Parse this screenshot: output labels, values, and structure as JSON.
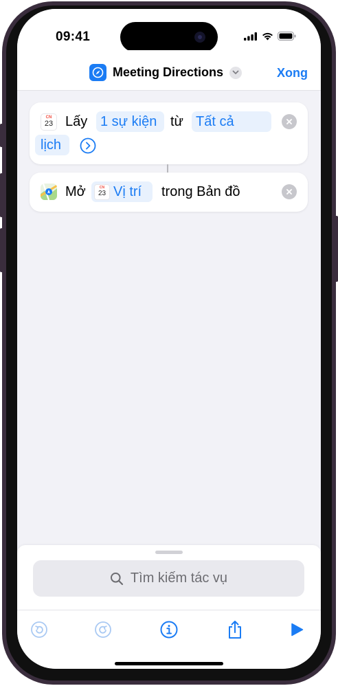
{
  "status_bar": {
    "time": "09:41"
  },
  "nav": {
    "title": "Meeting Directions",
    "done_label": "Xong"
  },
  "actions": [
    {
      "verb": "Lấy",
      "param_events": "1 sự kiện",
      "connector_word": "từ",
      "param_calendar_line1": "Tất cả",
      "param_calendar_line2": "lịch",
      "calendar_icon_day": "23"
    },
    {
      "verb": "Mở",
      "param_location": "Vị trí",
      "param_location_icon_day": "23",
      "suffix": "trong Bản đồ"
    }
  ],
  "search": {
    "placeholder": "Tìm kiếm tác vụ"
  },
  "toolbar": {
    "icons": [
      "undo-icon",
      "redo-icon",
      "info-icon",
      "share-icon",
      "play-icon"
    ]
  },
  "colors": {
    "accent": "#1b7cf4",
    "pill_background": "#e8f1fd",
    "screen_background": "#f2f2f7",
    "frame": "#3a2d3d"
  }
}
